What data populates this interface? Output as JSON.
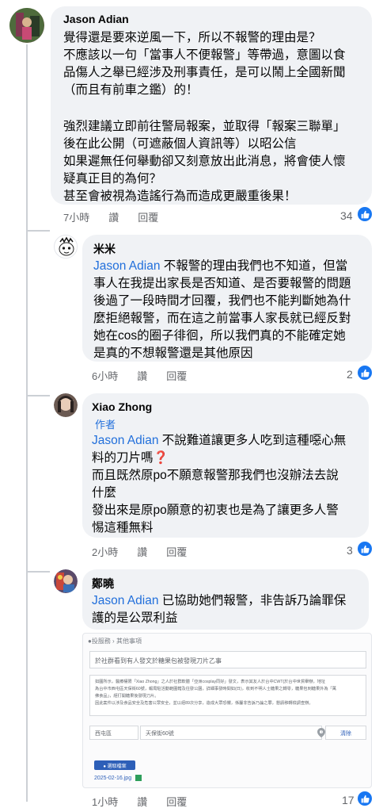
{
  "comments": [
    {
      "author": "Jason Adian",
      "lines": [
        "覺得還是要來逆風一下，所以不報警的理由是？",
        "不應該以一句「當事人不便報警」等帶過，意圖以食",
        "品傷人之舉已經涉及刑事責任，是可以鬧上全國新聞",
        "（而且有前車之鑑）的！",
        "",
        "強烈建議立即前往警局報案，並取得「報案三聯單」",
        "後在此公開（可遮蔽個人資訊等）以昭公信",
        "如果遲無任何舉動卻又刻意放出此消息，將會使人懷",
        "疑真正目的為何？",
        "甚至會被視為造謠行為而造成更嚴重後果！"
      ],
      "time": "7小時",
      "like": "讚",
      "reply": "回覆",
      "reactions": "34"
    },
    {
      "author": "米米",
      "mention": "Jason Adian",
      "lines": [
        " 不報警的理由我們也不知道，但當",
        "事人在我提出家長是否知道、是否要報警的問題",
        "後過了一段時間才回覆，我們也不能判斷她為什",
        "麼拒絕報警，而在這之前當事人家長就已經反對",
        "她在cos的圈子徘徊，所以我們真的不能確定她",
        "是真的不想報警還是其他原因"
      ],
      "time": "6小時",
      "like": "讚",
      "reply": "回覆",
      "reactions": "2"
    },
    {
      "author": "Xiao Zhong",
      "author_tag": "作者",
      "mention": "Jason Adian",
      "lines": [
        " 不說難道讓更多人吃到這種噁心無",
        "料的刀片嗎",
        "而且既然原po不願意報警那我們也沒辦法去說",
        "什麼",
        "發出來是原po願意的初衷也是為了讓更多人警",
        "惕這種無料"
      ],
      "emoji": "❓",
      "time": "2小時",
      "like": "讚",
      "reply": "回覆",
      "reactions": "3"
    },
    {
      "author": "鄭曉",
      "mention": "Jason Adian",
      "lines": [
        " 已協助她們報警，非告訴乃論罪保",
        "護的是公眾利益"
      ],
      "time": "1小時",
      "like": "讚",
      "reply": "回覆",
      "reactions": "17"
    }
  ],
  "attachment": {
    "header": "●投服務 › 其他事項",
    "subject": "於社群看到有人發文於糖果包被發現刀片乙事",
    "body_lines": [
      "如圖所示，醫療權限「Xiao Zhong」之人於社群軟體「亞洲cosplay同好」發文，表示其友人於台中CWT(於台中世貿舉辦，地址",
      "為台中市西屯區天保街60號，報局駐活動範圍轄及往發公園，詳細事發時間如(日)，收到不明人士糖果之轉零，糖果包到糖果外為「萬",
      "佛食品」，經打開糖果後發現刀片。",
      "因此案件以涉及食品安全及危害公眾安全，並以經89次分享，造成大眾恐懼，係屬非告訴乃論之罪，懇請移轉檢調查辦。"
    ],
    "district": "西屯區",
    "address": "天保街60號",
    "clear_label": "清除",
    "upload_label": "● 選取檔案",
    "file_name": "2025-02-16.jpg"
  }
}
